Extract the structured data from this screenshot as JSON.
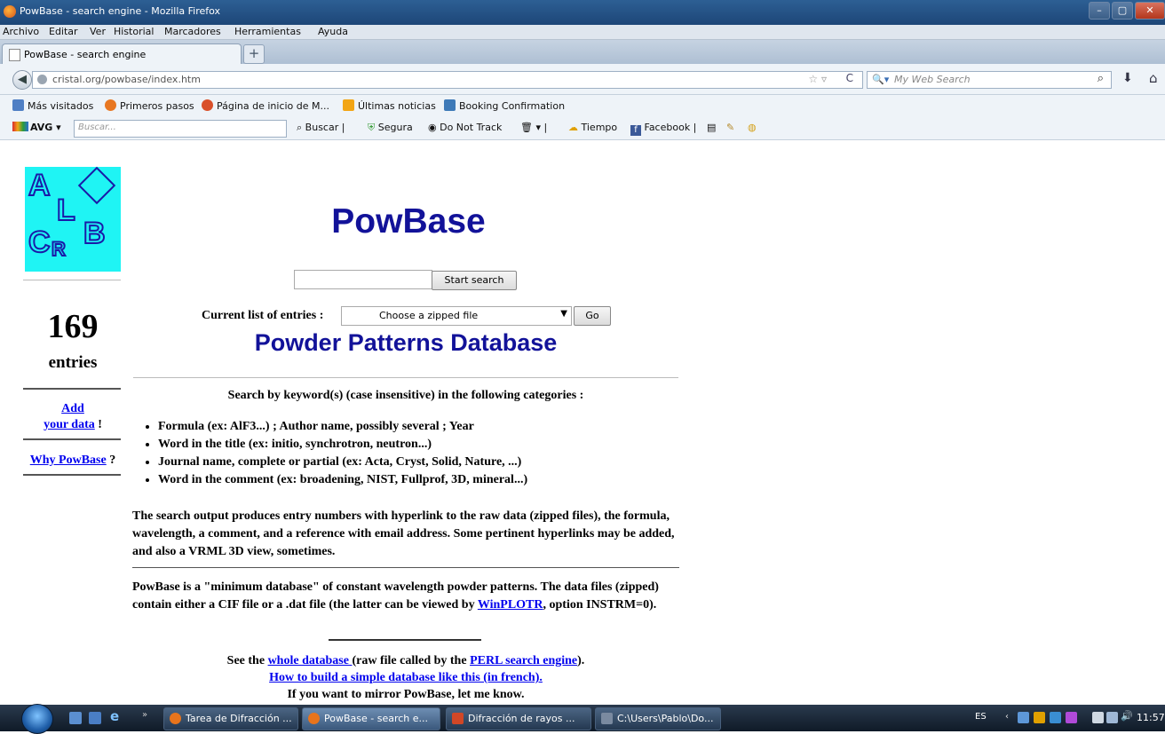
{
  "window": {
    "title": "PowBase - search engine - Mozilla Firefox",
    "controls": [
      "–",
      "▢",
      "✕"
    ]
  },
  "menubar": [
    "Archivo",
    "Editar",
    "Ver",
    "Historial",
    "Marcadores",
    "Herramientas",
    "Ayuda"
  ],
  "tab": {
    "label": "PowBase - search engine",
    "new_tab": "+"
  },
  "nav": {
    "url": "cristal.org/powbase/index.htm",
    "search_placeholder": "My Web Search"
  },
  "bookmarks": [
    {
      "label": "Más visitados",
      "color": "#4f7fc4"
    },
    {
      "label": "Primeros pasos",
      "color": "#e87722"
    },
    {
      "label": "Página de inicio de M...",
      "color": "#d9502a"
    },
    {
      "label": "Últimas noticias",
      "color": "#f2a515"
    },
    {
      "label": "Booking Confirmation",
      "color": "#3e7ab8"
    }
  ],
  "avg_toolbar": {
    "brand": "AVG",
    "search_placeholder": "Buscar...",
    "items": [
      "Buscar",
      "Segura",
      "Do Not Track",
      "Tiempo",
      "Facebook"
    ]
  },
  "sidebar": {
    "logo_letters": [
      "A",
      "L",
      "C",
      "R",
      "B"
    ],
    "count": "169",
    "entries_label": "entries",
    "add_link": "Add",
    "add_link2": "your data",
    "add_suffix": "!",
    "why_link": "Why PowBase",
    "why_suffix": "?"
  },
  "main": {
    "title": "PowBase",
    "search_button": "Start search",
    "current_list_label": "Current list of entries :",
    "select_value": "Choose a zipped file",
    "go_button": "Go",
    "subtitle": "Powder Patterns Database",
    "intro": "Search by keyword(s) (case insensitive) in the following categories :",
    "categories": [
      "Formula (ex: AlF3...) ; Author name, possibly several ; Year",
      "Word in the title (ex: initio, synchrotron, neutron...)",
      "Journal name, complete or partial (ex: Acta, Cryst, Solid, Nature, ...)",
      "Word in the comment (ex: broadening, NIST, Fullprof, 3D, mineral...)"
    ],
    "para1": "The search output produces entry numbers with hyperlink to the raw data (zipped files), the formula, wavelength, a comment, and a reference with email address. Some pertinent hyperlinks may be added, and also a VRML 3D view, sometimes.",
    "para2_a": "PowBase is a \"minimum database\" of constant wavelength powder patterns. The data files (zipped) contain either a CIF file or a .dat file (the latter can be viewed by ",
    "para2_link": "WinPLOTR",
    "para2_b": ", option INSTRM=0).",
    "footer1_a": "See the ",
    "footer1_link1": "whole database ",
    "footer1_b": "(raw file called by the ",
    "footer1_link2": "PERL search engine",
    "footer1_c": ").",
    "footer2_link": "How to build a simple database like this (in french).",
    "footer3": "If you want to mirror PowBase, let me know."
  },
  "taskbar": {
    "buttons": [
      {
        "label": "Tarea de Difracción ...",
        "color": "#e8741c"
      },
      {
        "label": "PowBase - search e...",
        "color": "#e8741c"
      },
      {
        "label": "Difracción de rayos ...",
        "color": "#d24726"
      },
      {
        "label": "C:\\Users\\Pablo\\Do...",
        "color": "#7a8aa0"
      }
    ],
    "lang": "ES",
    "clock": "11:57"
  }
}
